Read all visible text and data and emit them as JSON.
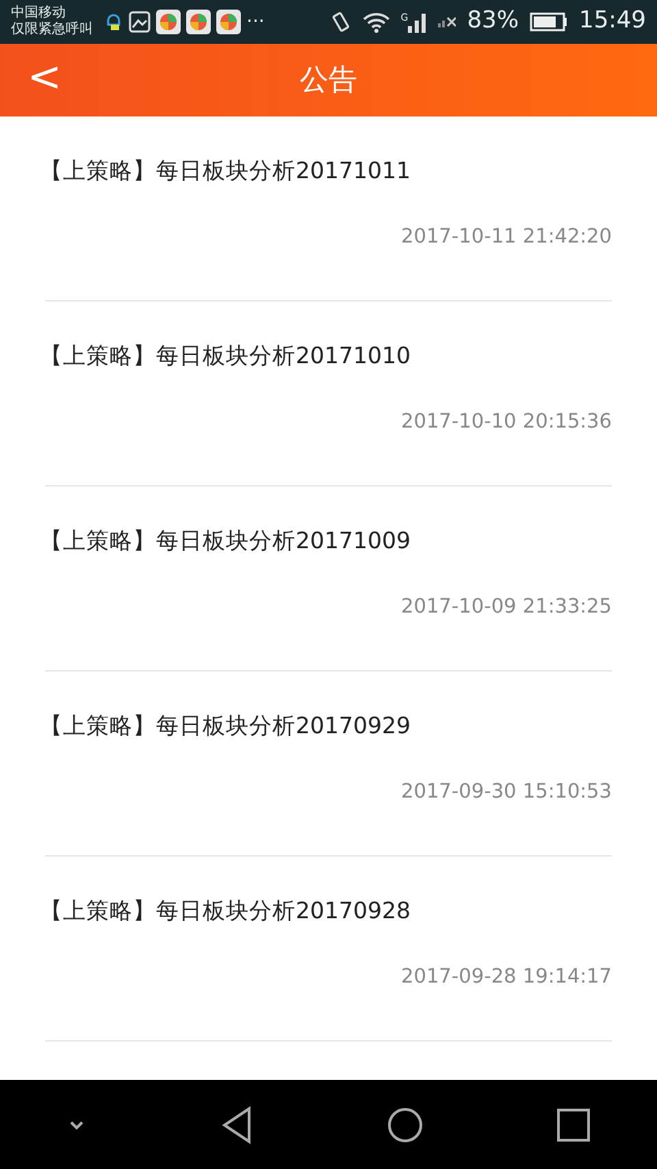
{
  "status_bar": {
    "carrier": "中国移动",
    "carrier_note": "仅限紧急呼叫",
    "overflow": "···",
    "network": "G",
    "battery_text": "83%",
    "time": "15:49"
  },
  "header": {
    "back": "<",
    "title": "公告"
  },
  "notices": [
    {
      "title": "【上策略】每日板块分析20171011",
      "date": "2017-10-11 21:42:20"
    },
    {
      "title": "【上策略】每日板块分析20171010",
      "date": "2017-10-10 20:15:36"
    },
    {
      "title": "【上策略】每日板块分析20171009",
      "date": "2017-10-09 21:33:25"
    },
    {
      "title": "【上策略】每日板块分析20170929",
      "date": "2017-09-30 15:10:53"
    },
    {
      "title": "【上策略】每日板块分析20170928",
      "date": "2017-09-28 19:14:17"
    }
  ]
}
